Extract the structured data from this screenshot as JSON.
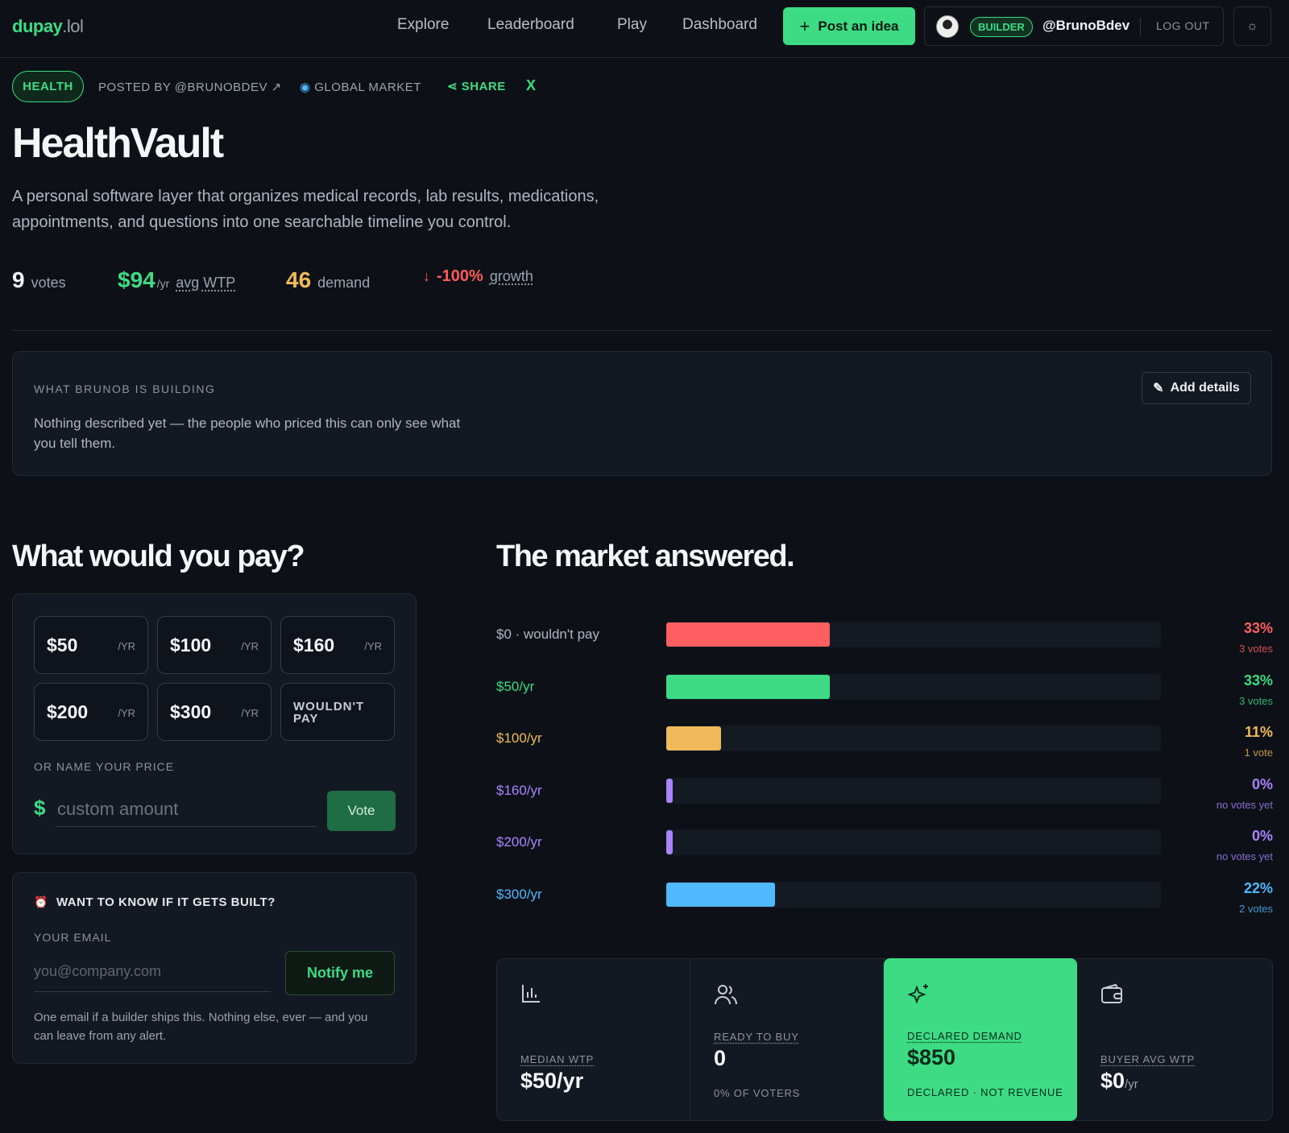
{
  "nav": {
    "logo_main": "dupay",
    "logo_tld": ".lol",
    "links": [
      "Explore",
      "Leaderboard",
      "Play",
      "Dashboard"
    ],
    "post_button": "Post an idea",
    "badge": "BUILDER",
    "username": "@BrunoBdev",
    "logout": "LOG OUT",
    "theme_icon": "sun-icon"
  },
  "idea": {
    "tag": "HEALTH",
    "posted_by": "POSTED BY @BRUNOBDEV ↗",
    "market": "GLOBAL MARKET",
    "share": "SHARE",
    "x": "X",
    "title": "HealthVault",
    "description": "A personal software layer that organizes medical records, lab results, medications, appointments, and questions into one searchable timeline you control."
  },
  "stats": {
    "votes_num": "9",
    "votes_label": "votes",
    "wtp_num": "$94",
    "wtp_unit": "/yr",
    "wtp_label": "avg WTP",
    "demand_num": "46",
    "demand_label": "demand",
    "growth_num": "-100%",
    "growth_label": "growth",
    "colors": {
      "wtp": "#3ddc84",
      "demand": "#f0b95a",
      "growth": "#ff5a5a"
    }
  },
  "building": {
    "caption": "WHAT BRUNOB IS BUILDING",
    "text": "Nothing described yet — the people who priced this can only see what you tell them.",
    "add_details": "Add details"
  },
  "pay": {
    "heading": "What would you pay?",
    "prices": [
      {
        "amount": "$50",
        "per": "/YR"
      },
      {
        "amount": "$100",
        "per": "/YR"
      },
      {
        "amount": "$160",
        "per": "/YR"
      },
      {
        "amount": "$200",
        "per": "/YR"
      },
      {
        "amount": "$300",
        "per": "/YR"
      }
    ],
    "wouldnt_pay": "WOULDN'T PAY",
    "or_name": "OR NAME YOUR PRICE",
    "currency": "$",
    "custom_placeholder": "custom amount",
    "vote_button": "Vote"
  },
  "notify": {
    "heading": "WANT TO KNOW IF IT GETS BUILT?",
    "email_label": "YOUR EMAIL",
    "email_placeholder": "you@company.com",
    "button": "Notify me",
    "fine_print": "One email if a builder ships this. Nothing else, ever — and you can leave from any alert."
  },
  "chart_data": {
    "type": "bar",
    "title": "The market answered.",
    "categories": [
      "$0 · wouldn't pay",
      "$50/yr",
      "$100/yr",
      "$160/yr",
      "$200/yr",
      "$300/yr"
    ],
    "values": [
      33,
      33,
      11,
      0,
      0,
      22
    ],
    "value_labels": [
      "33%",
      "33%",
      "11%",
      "0%",
      "0%",
      "22%"
    ],
    "vote_labels": [
      "3 votes",
      "3 votes",
      "1 vote",
      "no votes yet",
      "no votes yet",
      "2 votes"
    ],
    "colors": [
      "#ff5f5f",
      "#3ddc84",
      "#f0b95a",
      "#a884ff",
      "#a884ff",
      "#4fb8ff"
    ],
    "ylim": [
      0,
      100
    ]
  },
  "summary": [
    {
      "icon": "bar-chart-icon",
      "caption": "MEDIAN WTP",
      "value": "$50/yr",
      "suffix": "",
      "sub": ""
    },
    {
      "icon": "users-icon",
      "caption": "READY TO BUY",
      "value": "0",
      "suffix": "",
      "sub": "0% OF VOTERS"
    },
    {
      "icon": "sparkle-icon",
      "caption": "DECLARED DEMAND",
      "value": "$850",
      "suffix": "",
      "sub": "DECLARED · NOT REVENUE"
    },
    {
      "icon": "wallet-icon",
      "caption": "BUYER AVG WTP",
      "value": "$0",
      "suffix": "/yr",
      "sub": ""
    }
  ]
}
